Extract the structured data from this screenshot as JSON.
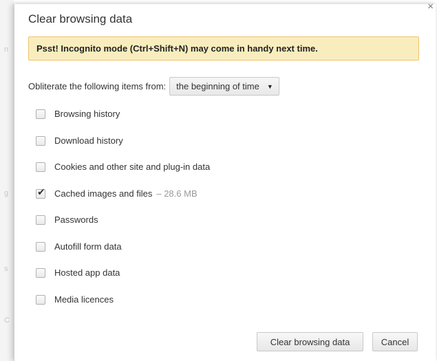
{
  "dialog": {
    "title": "Clear browsing data",
    "close_glyph": "×",
    "promo_text": "Psst! Incognito mode (Ctrl+Shift+N) may come in handy next time.",
    "obliterate_label": "Obliterate the following items from:",
    "time_range": {
      "selected": "the beginning of time"
    },
    "items": [
      {
        "label": "Browsing history",
        "checked": false,
        "note": ""
      },
      {
        "label": "Download history",
        "checked": false,
        "note": ""
      },
      {
        "label": "Cookies and other site and plug-in data",
        "checked": false,
        "note": ""
      },
      {
        "label": "Cached images and files",
        "checked": true,
        "note": "– 28.6 MB"
      },
      {
        "label": "Passwords",
        "checked": false,
        "note": ""
      },
      {
        "label": "Autofill form data",
        "checked": false,
        "note": ""
      },
      {
        "label": "Hosted app data",
        "checked": false,
        "note": ""
      },
      {
        "label": "Media licences",
        "checked": false,
        "note": ""
      }
    ],
    "buttons": {
      "clear_label": "Clear browsing data",
      "cancel_label": "Cancel"
    }
  },
  "background": {
    "edge_chars": [
      "n",
      "g",
      "s",
      "C"
    ]
  },
  "colors": {
    "promo_bg": "#f9edbe",
    "promo_border": "#f0c36d"
  }
}
